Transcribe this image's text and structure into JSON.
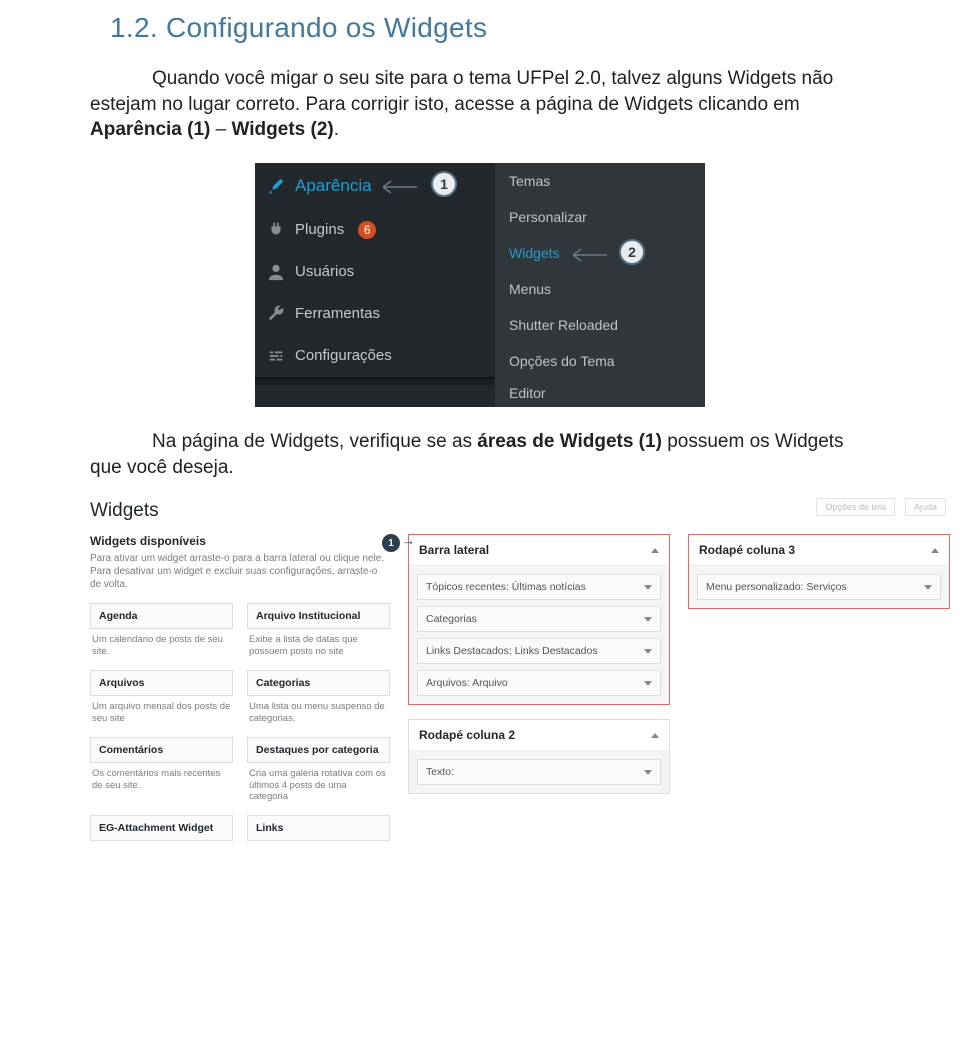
{
  "heading": "1.2. Configurando os Widgets",
  "para1_1": "Quando você migar o seu site para o tema UFPel 2.0, talvez alguns Widgets não estejam no lugar correto. Para corrigir isto, acesse a página de Widgets clicando em ",
  "para1_bold1": "Aparência (1)",
  "para1_mid": " – ",
  "para1_bold2": "Widgets (2)",
  "para1_end": ".",
  "para2_1": "Na página de Widgets, verifique se as ",
  "para2_bold": "áreas de Widgets (1)",
  "para2_2": " possuem os Widgets que você deseja.",
  "callout1": "1",
  "callout2": "2",
  "wp_left": [
    {
      "icon": "brush",
      "label": "Aparência",
      "active": true
    },
    {
      "icon": "plug",
      "label": "Plugins",
      "badge": "6"
    },
    {
      "icon": "user",
      "label": "Usuários"
    },
    {
      "icon": "wrench",
      "label": "Ferramentas"
    },
    {
      "icon": "sliders",
      "label": "Configurações"
    }
  ],
  "wp_right": [
    {
      "label": "Temas"
    },
    {
      "label": "Personalizar"
    },
    {
      "label": "Widgets",
      "highlight": true
    },
    {
      "label": "Menus"
    },
    {
      "label": "Shutter Reloaded"
    },
    {
      "label": "Opções do Tema"
    },
    {
      "label": "Editor"
    }
  ],
  "wg": {
    "top_btns": [
      "Opções de tela",
      "Ajuda"
    ],
    "title": "Widgets",
    "sub": "Widgets disponíveis",
    "desc": "Para ativar um widget arraste-o para a barra lateral ou clique nele. Para desativar um widget e excluir suas configurações, arraste-o de volta.",
    "avail": [
      {
        "name": "Agenda",
        "txt": "Um calendário de posts de seu site."
      },
      {
        "name": "Arquivo Institucional",
        "txt": "Exibe a lista de datas que possuem posts no site"
      },
      {
        "name": "Arquivos",
        "txt": "Um arquivo mensal dos posts de seu site"
      },
      {
        "name": "Categorias",
        "txt": "Uma lista ou menu suspenso de categorias."
      },
      {
        "name": "Comentários",
        "txt": "Os comentários mais recentes de seu site."
      },
      {
        "name": "Destaques por categoria",
        "txt": "Cria uma galeria rotativa com os últimos 4 posts de uma categoria"
      },
      {
        "name": "EG-Attachment Widget",
        "txt": ""
      },
      {
        "name": "Links",
        "txt": ""
      }
    ],
    "badge1": "1",
    "areas_left": [
      {
        "title": "Barra lateral",
        "open": true,
        "items": [
          "Tópicos recentes: Últimas notícias",
          "Categorias",
          "Links Destacados: Links Destacados",
          "Arquivos: Arquivo"
        ]
      },
      {
        "title": "Rodapé coluna 2",
        "open": true,
        "items": [
          "Texto:"
        ]
      }
    ],
    "areas_right": [
      {
        "title": "Rodapé coluna 3",
        "open": true,
        "items": [
          "Menu personalizado: Serviços"
        ]
      }
    ]
  }
}
